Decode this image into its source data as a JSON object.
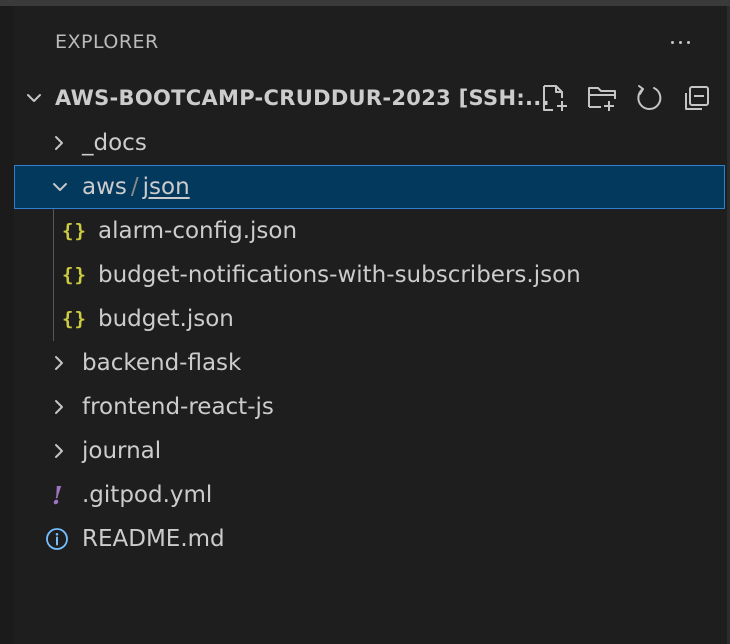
{
  "explorer": {
    "title": "EXPLORER",
    "more_icon": "ellipsis-icon"
  },
  "root": {
    "label": "AWS-BOOTCAMP-CRUDDUR-2023 [SSH:...",
    "expanded": true,
    "actions": [
      {
        "name": "new-file",
        "icon": "new-file-icon"
      },
      {
        "name": "new-folder",
        "icon": "new-folder-icon"
      },
      {
        "name": "refresh",
        "icon": "refresh-icon"
      },
      {
        "name": "collapse-all",
        "icon": "collapse-all-icon"
      }
    ]
  },
  "tree": {
    "docs": {
      "label": "_docs",
      "type": "folder",
      "expanded": false
    },
    "aws": {
      "label": "aws",
      "separator": "/",
      "sub_label": "json",
      "type": "folder",
      "expanded": true,
      "selected": true
    },
    "alarm_config": {
      "label": "alarm-config.json",
      "icon": "{}",
      "type": "json"
    },
    "budget_notifications": {
      "label": "budget-notifications-with-subscribers.json",
      "icon": "{}",
      "type": "json"
    },
    "budget": {
      "label": "budget.json",
      "icon": "{}",
      "type": "json"
    },
    "backend": {
      "label": "backend-flask",
      "type": "folder",
      "expanded": false
    },
    "frontend": {
      "label": "frontend-react-js",
      "type": "folder",
      "expanded": false
    },
    "journal": {
      "label": "journal",
      "type": "folder",
      "expanded": false
    },
    "gitpod": {
      "label": ".gitpod.yml",
      "icon": "!",
      "type": "yml"
    },
    "readme": {
      "label": "README.md",
      "icon": "info-icon",
      "type": "markdown"
    }
  },
  "colors": {
    "background": "#1e1e1e",
    "selection": "#04395e",
    "selection_border": "#2f7fd1",
    "json_icon": "#cbcb41",
    "yml_icon": "#a074c4",
    "text": "#cccccc"
  }
}
